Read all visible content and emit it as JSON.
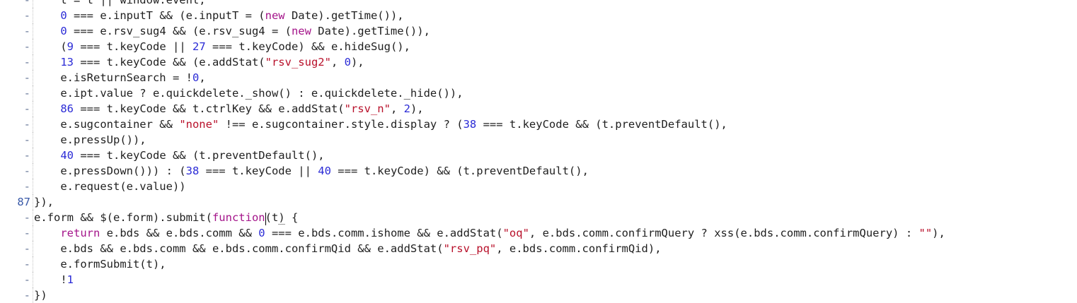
{
  "editor": {
    "lines": [
      {
        "gutter": "-",
        "indent": 1,
        "tokens": [
          [
            "p",
            "t = t || window.event,"
          ]
        ]
      },
      {
        "gutter": "-",
        "indent": 1,
        "tokens": [
          [
            "n",
            "0"
          ],
          [
            "p",
            " === e.inputT && (e.inputT = ("
          ],
          [
            "k",
            "new"
          ],
          [
            "p",
            " Date).getTime()),"
          ]
        ]
      },
      {
        "gutter": "-",
        "indent": 1,
        "tokens": [
          [
            "n",
            "0"
          ],
          [
            "p",
            " === e.rsv_sug4 && (e.rsv_sug4 = ("
          ],
          [
            "k",
            "new"
          ],
          [
            "p",
            " Date).getTime()),"
          ]
        ]
      },
      {
        "gutter": "-",
        "indent": 1,
        "tokens": [
          [
            "p",
            "("
          ],
          [
            "n",
            "9"
          ],
          [
            "p",
            " === t.keyCode || "
          ],
          [
            "n",
            "27"
          ],
          [
            "p",
            " === t.keyCode) && e.hideSug(),"
          ]
        ]
      },
      {
        "gutter": "-",
        "indent": 1,
        "tokens": [
          [
            "n",
            "13"
          ],
          [
            "p",
            " === t.keyCode && (e.addStat("
          ],
          [
            "s",
            "\"rsv_sug2\""
          ],
          [
            "p",
            ", "
          ],
          [
            "n",
            "0"
          ],
          [
            "p",
            "),"
          ]
        ]
      },
      {
        "gutter": "-",
        "indent": 1,
        "tokens": [
          [
            "p",
            "e.isReturnSearch = !"
          ],
          [
            "n",
            "0"
          ],
          [
            "p",
            ","
          ]
        ]
      },
      {
        "gutter": "-",
        "indent": 1,
        "tokens": [
          [
            "p",
            "e.ipt.value ? e.quickdelete._show() : e.quickdelete._hide()),"
          ]
        ]
      },
      {
        "gutter": "-",
        "indent": 1,
        "tokens": [
          [
            "n",
            "86"
          ],
          [
            "p",
            " === t.keyCode && t.ctrlKey && e.addStat("
          ],
          [
            "s",
            "\"rsv_n\""
          ],
          [
            "p",
            ", "
          ],
          [
            "n",
            "2"
          ],
          [
            "p",
            "),"
          ]
        ]
      },
      {
        "gutter": "-",
        "indent": 1,
        "tokens": [
          [
            "p",
            "e.sugcontainer && "
          ],
          [
            "s",
            "\"none\""
          ],
          [
            "p",
            " !== e.sugcontainer.style.display ? ("
          ],
          [
            "n",
            "38"
          ],
          [
            "p",
            " === t.keyCode && (t.preventDefault(),"
          ]
        ]
      },
      {
        "gutter": "-",
        "indent": 1,
        "tokens": [
          [
            "p",
            "e.pressUp()),"
          ]
        ]
      },
      {
        "gutter": "-",
        "indent": 1,
        "tokens": [
          [
            "n",
            "40"
          ],
          [
            "p",
            " === t.keyCode && (t.preventDefault(),"
          ]
        ]
      },
      {
        "gutter": "-",
        "indent": 1,
        "tokens": [
          [
            "p",
            "e.pressDown())) : ("
          ],
          [
            "n",
            "38"
          ],
          [
            "p",
            " === t.keyCode || "
          ],
          [
            "n",
            "40"
          ],
          [
            "p",
            " === t.keyCode) && (t.preventDefault(),"
          ]
        ]
      },
      {
        "gutter": "-",
        "indent": 1,
        "tokens": [
          [
            "p",
            "e.request(e.value))"
          ]
        ]
      },
      {
        "gutter": "87",
        "indent": 0,
        "tokens": [
          [
            "p",
            "}),"
          ]
        ]
      },
      {
        "gutter": "-",
        "indent": 0,
        "tokens": [
          [
            "p",
            "e.form && $(e.form).submit("
          ],
          [
            "k",
            "function"
          ],
          [
            "cursor",
            "("
          ],
          [
            "p",
            "t"
          ],
          [
            "match",
            ")"
          ],
          [
            "p",
            " {"
          ]
        ]
      },
      {
        "gutter": "-",
        "indent": 1,
        "tokens": [
          [
            "k",
            "return"
          ],
          [
            "p",
            " e.bds && e.bds.comm && "
          ],
          [
            "n",
            "0"
          ],
          [
            "p",
            " === e.bds.comm.ishome && e.addStat("
          ],
          [
            "s",
            "\"oq\""
          ],
          [
            "p",
            ", e.bds.comm.confirmQuery ? xss(e.bds.comm.confirmQuery) : "
          ],
          [
            "s",
            "\"\""
          ],
          [
            "p",
            "),"
          ]
        ]
      },
      {
        "gutter": "-",
        "indent": 1,
        "tokens": [
          [
            "p",
            "e.bds && e.bds.comm && e.bds.comm.confirmQid && e.addStat("
          ],
          [
            "s",
            "\"rsv_pq\""
          ],
          [
            "p",
            ", e.bds.comm.confirmQid),"
          ]
        ]
      },
      {
        "gutter": "-",
        "indent": 1,
        "tokens": [
          [
            "p",
            "e.formSubmit(t),"
          ]
        ]
      },
      {
        "gutter": "-",
        "indent": 1,
        "tokens": [
          [
            "p",
            "!"
          ],
          [
            "n",
            "1"
          ]
        ]
      },
      {
        "gutter": "-",
        "indent": 0,
        "tokens": [
          [
            "p",
            "})"
          ]
        ]
      }
    ]
  }
}
